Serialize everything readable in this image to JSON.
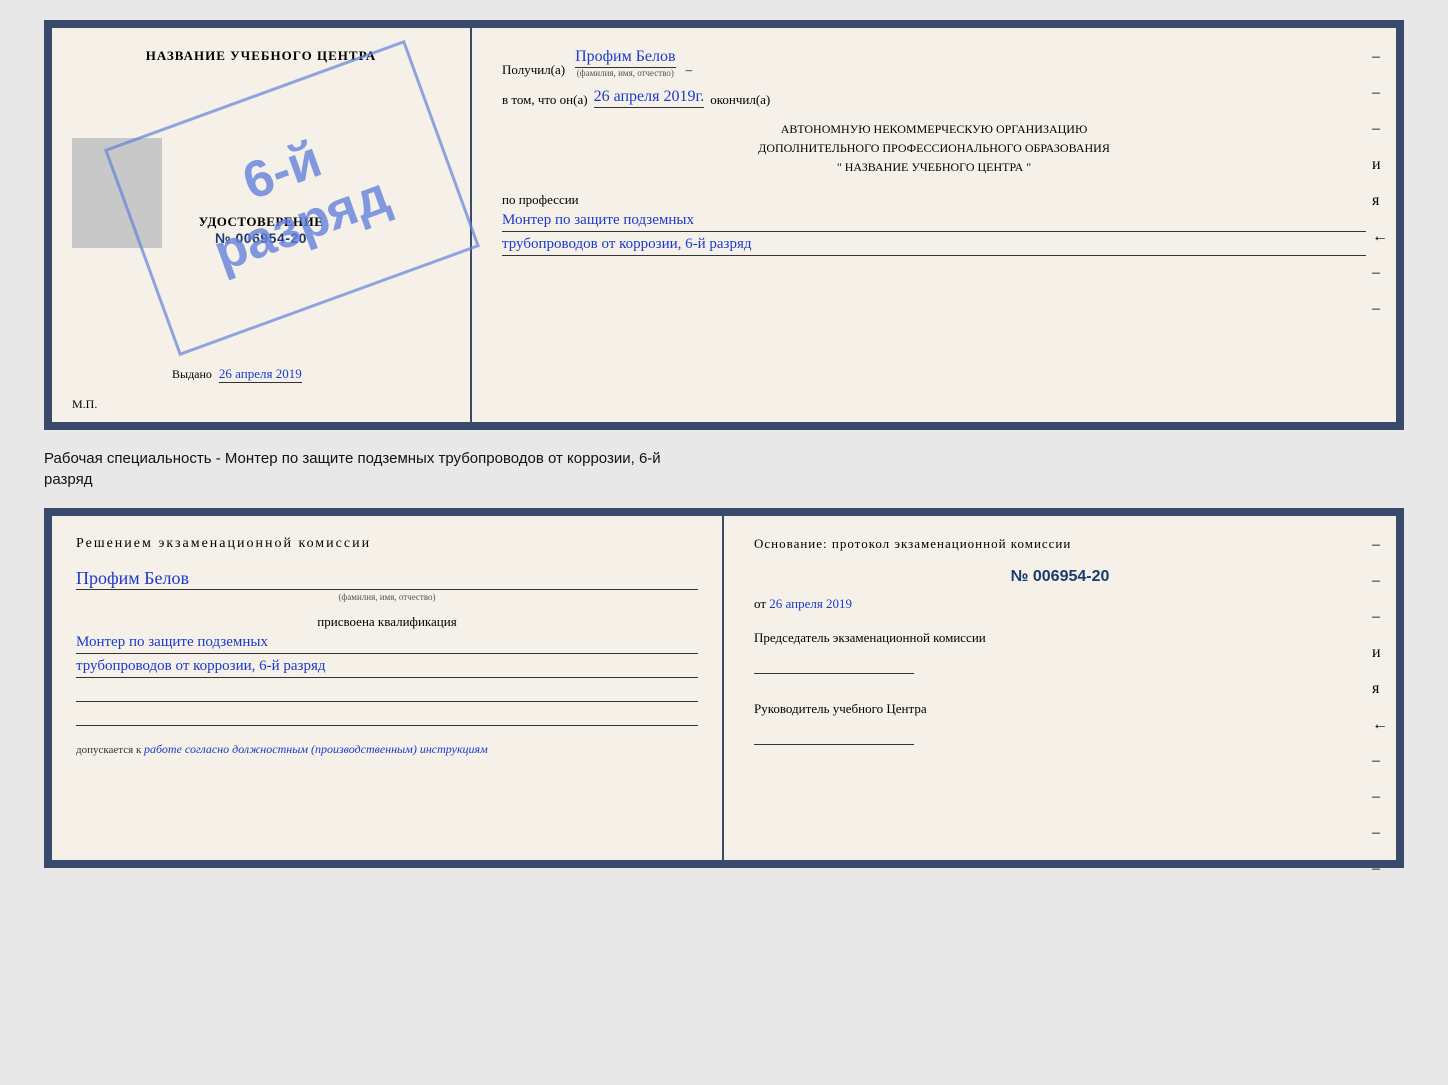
{
  "top_cert": {
    "left": {
      "title": "НАЗВАНИЕ УЧЕБНОГО ЦЕНТРА",
      "udostoverenie": "УДОСТОВЕРЕНИЕ",
      "number": "№ 006954-20",
      "vydano_label": "Выдано",
      "vydano_date": "26 апреля 2019",
      "mp": "М.П."
    },
    "stamp": {
      "line1": "6-й",
      "line2": "разряд"
    },
    "right": {
      "poluchil_label": "Получил(а)",
      "name_handwritten": "Профим Белов",
      "name_subtext": "(фамилия, имя, отчество)",
      "dash": "–",
      "vtom_label": "в том, что он(а)",
      "date_handwritten": "26 апреля 2019г.",
      "okonchil_label": "окончил(а)",
      "org_line1": "АВТОНОМНУЮ НЕКОММЕРЧЕСКУЮ ОРГАНИЗАЦИЮ",
      "org_line2": "ДОПОЛНИТЕЛЬНОГО ПРОФЕССИОНАЛЬНОГО ОБРАЗОВАНИЯ",
      "org_line3": "\"  НАЗВАНИЕ УЧЕБНОГО ЦЕНТРА  \"",
      "profession_label": "по профессии",
      "profession_line1": "Монтер по защите подземных",
      "profession_line2": "трубопроводов от коррозии, 6-й разряд"
    }
  },
  "middle_text": {
    "line1": "Рабочая специальность - Монтер по защите подземных трубопроводов от коррозии, 6-й",
    "line2": "разряд"
  },
  "bottom_cert": {
    "left": {
      "title": "Решением экзаменационной комиссии",
      "name_handwritten": "Профим Белов",
      "name_subtext": "(фамилия, имя, отчество)",
      "prisvoena_label": "присвоена квалификация",
      "qual_line1": "Монтер по защите подземных",
      "qual_line2": "трубопроводов от коррозии, 6-й разряд",
      "dopuskaetsya_label": "допускается к",
      "dopuskaetsya_text": "работе согласно должностным (производственным) инструкциям"
    },
    "right": {
      "osnov_label": "Основание: протокол экзаменационной комиссии",
      "number": "№  006954-20",
      "date_prefix": "от",
      "date_handwritten": "26 апреля 2019",
      "predsedatel_label": "Председатель экзаменационной комиссии",
      "rukovoditel_label": "Руководитель учебного Центра"
    }
  },
  "side_marks": {
    "and": "и",
    "ya": "я",
    "arrow": "←",
    "dashes": [
      "–",
      "–",
      "–",
      "–",
      "–",
      "–",
      "–",
      "–"
    ]
  }
}
